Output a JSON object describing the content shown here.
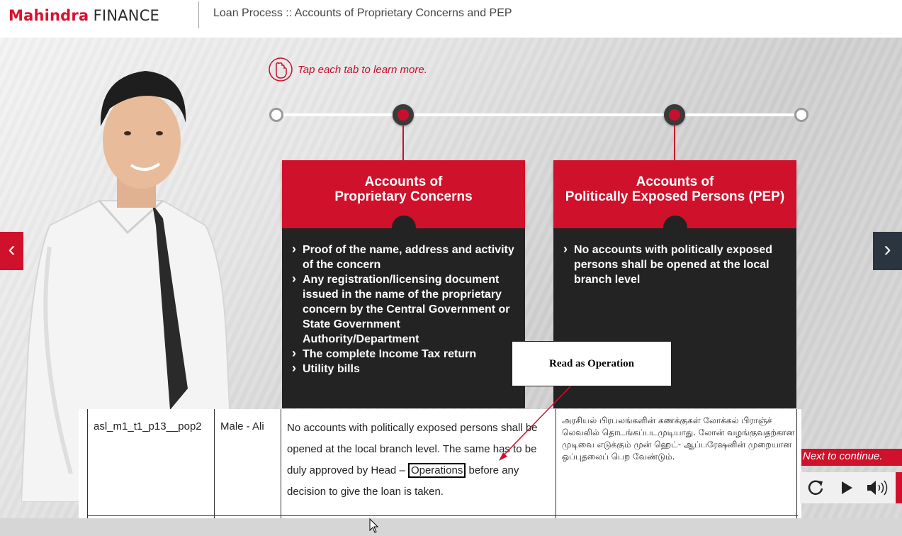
{
  "header": {
    "brand": "Mahindra",
    "brand_suffix": "FINANCE",
    "title": "Loan Process :: Accounts of Proprietary Concerns and PEP"
  },
  "hint": {
    "text": "Tap each tab to learn more.",
    "icon": "tap-hand-icon"
  },
  "cards": [
    {
      "title_line1": "Accounts of",
      "title_line2": "Proprietary Concerns",
      "items": [
        "Proof of the name, address and activity of the concern",
        "Any registration/licensing document issued in the name of the proprietary concern by the Central Government or State Government Authority/Department",
        "The complete Income Tax return",
        "Utility bills"
      ]
    },
    {
      "title_line1": "Accounts of",
      "title_line2": "Politically Exposed Persons (PEP)",
      "items": [
        "No accounts with politically exposed persons shall be opened at the local branch level"
      ]
    }
  ],
  "annotation": {
    "text": "Read as Operation"
  },
  "review_row": {
    "id": "asl_m1_t1_p13__pop2",
    "voice": "Male - Ali",
    "text_before": "No accounts with politically exposed persons shall be opened at the local branch level. The same has to be duly approved by Head – ",
    "text_highlight": "Operations",
    "text_after": " before any decision to give the loan is taken.",
    "tamil": "அரசியல் பிரபலங்களின் கணக்குகள் லோக்கல் பிராஞ்ச் லெவலில் தொடங்கப்படமுடியாது. லோன் வழங்குவதற்கான முடிவை எடுக்கும் முன் ஹெட்- ஆப்பரேஷனின் முறையான ஒப்புதலைப் பெற வேண்டும்."
  },
  "controls": {
    "next_label": "Next to continue.",
    "replay_icon": "replay-icon",
    "play_icon": "play-icon",
    "volume_icon": "volume-icon"
  },
  "nav": {
    "prev_icon": "chevron-left-icon",
    "next_icon": "chevron-right-icon"
  },
  "colors": {
    "brand_red": "#d0112b",
    "card_dark": "#232323",
    "nav_dark": "#2b3540"
  }
}
